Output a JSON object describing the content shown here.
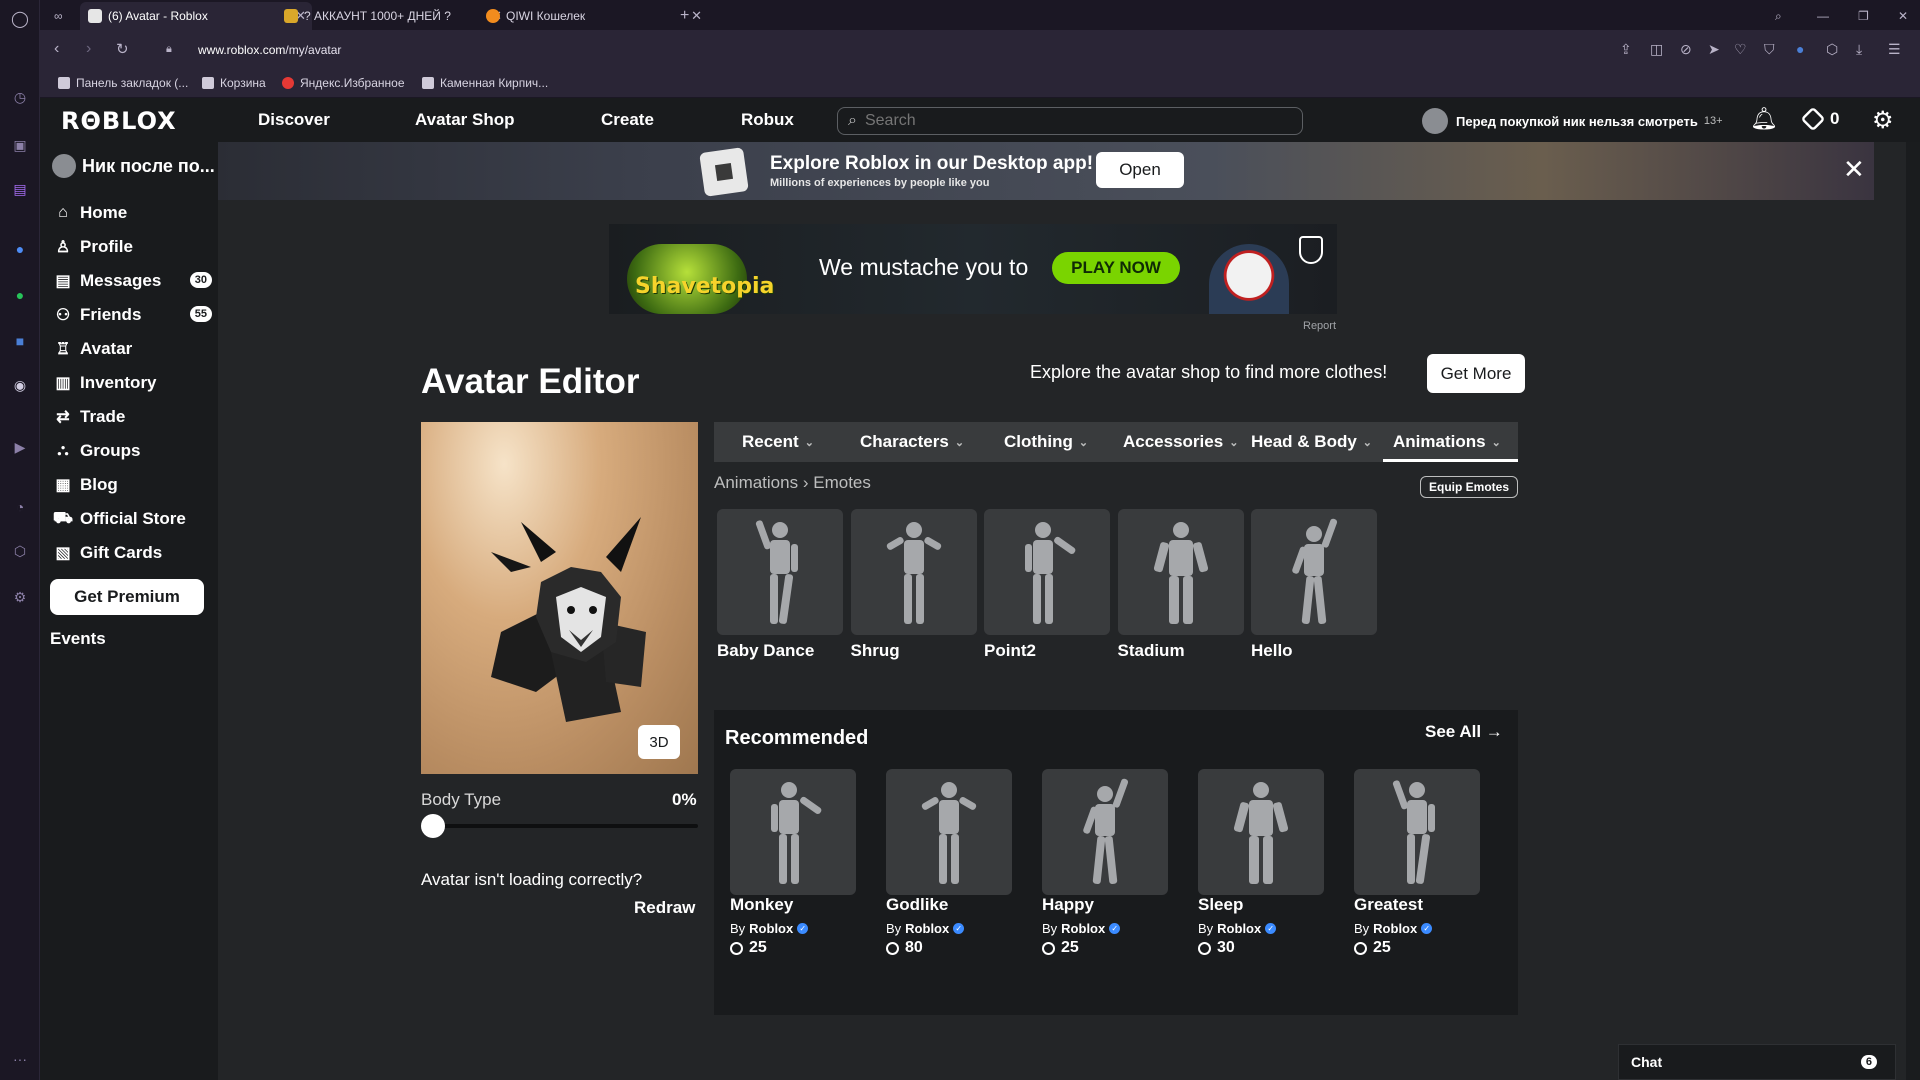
{
  "browser": {
    "tabs": [
      {
        "label": "(6) Avatar - Roblox",
        "favicon_color": "#e6e6e6"
      },
      {
        "label": "? АККАУНТ 1000+ ДНЕЙ ?",
        "favicon_color": "#d9a72a"
      },
      {
        "label": "QIWI Кошелек",
        "favicon_color": "#f28c1e"
      }
    ],
    "new_tab": "+",
    "url_host": "www.roblox.com",
    "url_path": "/my/avatar",
    "bookmarks": [
      "Панель закладок (...",
      "Корзина",
      "Яндекс.Избранное",
      "Каменная Кирпич..."
    ]
  },
  "header": {
    "logo": "RΘBLOX",
    "nav": [
      "Discover",
      "Avatar Shop",
      "Create",
      "Robux"
    ],
    "search_placeholder": "Search",
    "user_label": "Перед покупкой ник нельзя смотреть",
    "age": "13+",
    "robux": "0"
  },
  "sidebar": {
    "username": "Ник после по...",
    "items": [
      {
        "label": "Home",
        "icon": "home-icon"
      },
      {
        "label": "Profile",
        "icon": "profile-icon"
      },
      {
        "label": "Messages",
        "icon": "messages-icon",
        "badge": "30"
      },
      {
        "label": "Friends",
        "icon": "friends-icon",
        "badge": "55"
      },
      {
        "label": "Avatar",
        "icon": "avatar-icon"
      },
      {
        "label": "Inventory",
        "icon": "inventory-icon"
      },
      {
        "label": "Trade",
        "icon": "trade-icon"
      },
      {
        "label": "Groups",
        "icon": "groups-icon"
      },
      {
        "label": "Blog",
        "icon": "blog-icon"
      },
      {
        "label": "Official Store",
        "icon": "store-icon"
      },
      {
        "label": "Gift Cards",
        "icon": "gift-card-icon"
      }
    ],
    "premium_button": "Get Premium",
    "events": "Events"
  },
  "promo": {
    "title": "Explore Roblox in our Desktop app!",
    "subtitle": "Millions of experiences by people like you",
    "open_button": "Open"
  },
  "ad": {
    "brand": "Shavetopia",
    "text": "We mustache you to",
    "cta": "PLAY NOW",
    "report": "Report"
  },
  "editor": {
    "title": "Avatar Editor",
    "explore_text": "Explore the avatar shop to find more clothes!",
    "get_more": "Get More",
    "view_3d": "3D",
    "body_type_label": "Body Type",
    "body_type_value": "0%",
    "body_type_level": 0,
    "loading_question": "Avatar isn't loading correctly?",
    "redraw": "Redraw",
    "tabs": [
      "Recent",
      "Characters",
      "Clothing",
      "Accessories",
      "Head & Body",
      "Animations"
    ],
    "active_tab": "Animations",
    "breadcrumb_parent": "Animations",
    "breadcrumb_sep": "›",
    "breadcrumb_current": "Emotes",
    "equip_button": "Equip Emotes",
    "emotes": [
      "Baby Dance",
      "Shrug",
      "Point2",
      "Stadium",
      "Hello"
    ]
  },
  "recommended": {
    "title": "Recommended",
    "see_all": "See All →",
    "by_label": "By",
    "items": [
      {
        "name": "Monkey",
        "creator": "Roblox",
        "price": "25"
      },
      {
        "name": "Godlike",
        "creator": "Roblox",
        "price": "80"
      },
      {
        "name": "Happy",
        "creator": "Roblox",
        "price": "25"
      },
      {
        "name": "Sleep",
        "creator": "Roblox",
        "price": "30"
      },
      {
        "name": "Greatest",
        "creator": "Roblox",
        "price": "25"
      }
    ]
  },
  "chat": {
    "label": "Chat",
    "count": "6"
  },
  "colors": {
    "accent_green": "#7ad400",
    "verified_blue": "#3b8bff",
    "page_bg": "#232527"
  }
}
